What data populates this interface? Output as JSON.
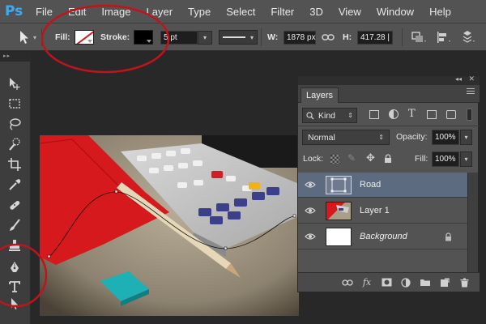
{
  "app": {
    "logo": "Ps"
  },
  "menu": [
    "File",
    "Edit",
    "Image",
    "Layer",
    "Type",
    "Select",
    "Filter",
    "3D",
    "View",
    "Window",
    "Help"
  ],
  "options": {
    "fill_label": "Fill:",
    "stroke_label": "Stroke:",
    "stroke_width": "5 pt",
    "w_label": "W:",
    "w_value": "1878 px",
    "h_label": "H:",
    "h_value": "417.28 |"
  },
  "layers_panel": {
    "tab": "Layers",
    "filter_kind": "Kind",
    "blend_mode": "Normal",
    "opacity_label": "Opacity:",
    "opacity_value": "100%",
    "lock_label": "Lock:",
    "fill_label": "Fill:",
    "fill_value": "100%",
    "layers": [
      {
        "name": "Road",
        "active": true,
        "visible": true
      },
      {
        "name": "Layer 1",
        "active": false,
        "visible": true
      },
      {
        "name": "Background",
        "active": false,
        "visible": true,
        "locked": true
      }
    ]
  },
  "colors": {
    "fill_swatch": "#ffffff",
    "stroke_swatch": "#000000",
    "highlight": "#c0141c",
    "active_layer": "#5d6b80",
    "ps_logo": "#3fa9f5"
  },
  "icons": {
    "bottom_bar": [
      "link-icon",
      "fx-icon",
      "mask-icon",
      "adjustment-icon",
      "folder-icon",
      "new-layer-icon",
      "trash-icon"
    ]
  }
}
